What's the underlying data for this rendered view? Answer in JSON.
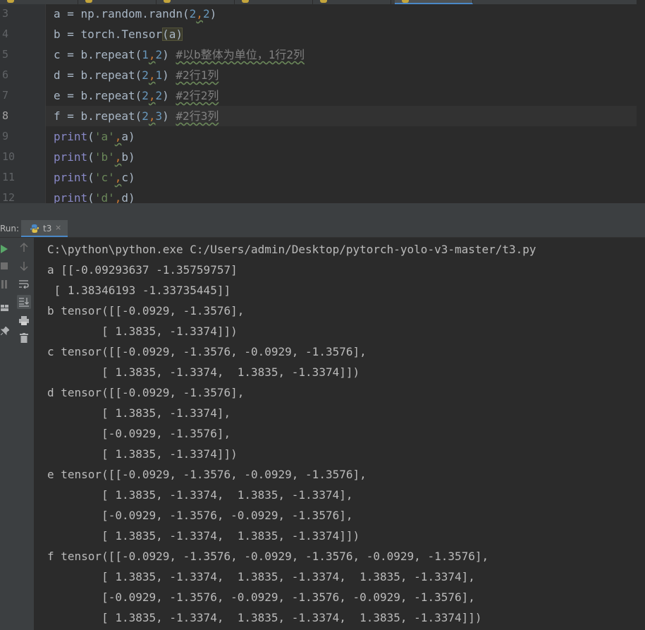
{
  "editor": {
    "line_numbers": [
      "3",
      "4",
      "5",
      "6",
      "7",
      "8",
      "9",
      "10",
      "11",
      "12"
    ],
    "current_line": "8",
    "lines": [
      [
        [
          "fn",
          "a = np.random.randn("
        ],
        [
          "num",
          "2"
        ],
        [
          "sep",
          ","
        ],
        [
          "num",
          "2"
        ],
        [
          "fn",
          ")"
        ]
      ],
      [
        [
          "fn",
          "b = torch.Tensor"
        ],
        [
          "hl",
          "(a)"
        ]
      ],
      [
        [
          "fn",
          "c = b.repeat("
        ],
        [
          "num",
          "1"
        ],
        [
          "sep",
          ","
        ],
        [
          "num",
          "2"
        ],
        [
          "fn",
          ") "
        ],
        [
          "cmt",
          "#以b整体为单位，1行2列"
        ]
      ],
      [
        [
          "fn",
          "d = b.repeat("
        ],
        [
          "num",
          "2"
        ],
        [
          "sep",
          ","
        ],
        [
          "num",
          "1"
        ],
        [
          "fn",
          ") "
        ],
        [
          "cmt",
          "#2行1列"
        ]
      ],
      [
        [
          "fn",
          "e = b.repeat("
        ],
        [
          "num",
          "2"
        ],
        [
          "sep",
          ","
        ],
        [
          "num",
          "2"
        ],
        [
          "fn",
          ") "
        ],
        [
          "cmt",
          "#2行2列"
        ]
      ],
      [
        [
          "fn",
          "f = b.repeat("
        ],
        [
          "num",
          "2"
        ],
        [
          "sep",
          ","
        ],
        [
          "num",
          "3"
        ],
        [
          "fn",
          ") "
        ],
        [
          "cmt",
          "#2行3列"
        ]
      ],
      [
        [
          "builtin",
          "print"
        ],
        [
          "fn",
          "("
        ],
        [
          "str",
          "'a'"
        ],
        [
          "sep",
          ","
        ],
        [
          "fn",
          "a)"
        ]
      ],
      [
        [
          "builtin",
          "print"
        ],
        [
          "fn",
          "("
        ],
        [
          "str",
          "'b'"
        ],
        [
          "sep",
          ","
        ],
        [
          "fn",
          "b)"
        ]
      ],
      [
        [
          "builtin",
          "print"
        ],
        [
          "fn",
          "("
        ],
        [
          "str",
          "'c'"
        ],
        [
          "sep",
          ","
        ],
        [
          "fn",
          "c)"
        ]
      ],
      [
        [
          "builtin",
          "print"
        ],
        [
          "fn",
          "("
        ],
        [
          "str",
          "'d'"
        ],
        [
          "sep",
          ","
        ],
        [
          "fn",
          "d)"
        ]
      ]
    ]
  },
  "run": {
    "label": "Run:",
    "tab_name": "t3",
    "close_glyph": "×",
    "toolbar_icons": [
      "rerun-icon",
      "stop-icon",
      "pause-icon",
      "layout-icon",
      "pin-icon"
    ],
    "console_tools": [
      "up-arrow-icon",
      "down-arrow-icon",
      "soft-wrap-icon",
      "scroll-to-end-icon",
      "print-icon",
      "trash-icon"
    ],
    "output": [
      "C:\\python\\python.exe C:/Users/admin/Desktop/pytorch-yolo-v3-master/t3.py",
      "a [[-0.09293637 -1.35759757]",
      " [ 1.38346193 -1.33735445]]",
      "b tensor([[-0.0929, -1.3576],",
      "        [ 1.3835, -1.3374]])",
      "c tensor([[-0.0929, -1.3576, -0.0929, -1.3576],",
      "        [ 1.3835, -1.3374,  1.3835, -1.3374]])",
      "d tensor([[-0.0929, -1.3576],",
      "        [ 1.3835, -1.3374],",
      "        [-0.0929, -1.3576],",
      "        [ 1.3835, -1.3374]])",
      "e tensor([[-0.0929, -1.3576, -0.0929, -1.3576],",
      "        [ 1.3835, -1.3374,  1.3835, -1.3374],",
      "        [-0.0929, -1.3576, -0.0929, -1.3576],",
      "        [ 1.3835, -1.3374,  1.3835, -1.3374]])",
      "f tensor([[-0.0929, -1.3576, -0.0929, -1.3576, -0.0929, -1.3576],",
      "        [ 1.3835, -1.3374,  1.3835, -1.3374,  1.3835, -1.3374],",
      "        [-0.0929, -1.3576, -0.0929, -1.3576, -0.0929, -1.3576],",
      "        [ 1.3835, -1.3374,  1.3835, -1.3374,  1.3835, -1.3374]])"
    ]
  },
  "colors": {
    "background": "#2b2b2b",
    "panel": "#3c3f41",
    "run_green": "#59a869",
    "accent": "#4a88c7"
  }
}
